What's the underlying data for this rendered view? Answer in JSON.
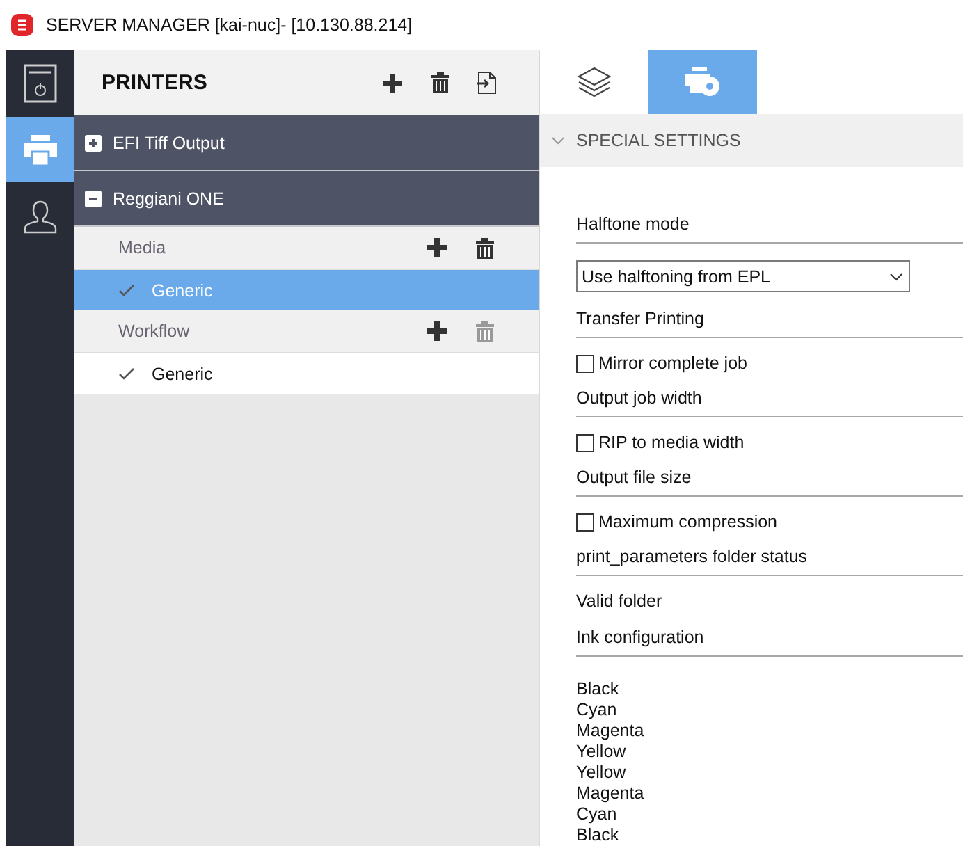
{
  "window": {
    "title": "SERVER MANAGER [kai-nuc]- [10.130.88.214]"
  },
  "nav": [
    {
      "kind": "server",
      "selected": false
    },
    {
      "kind": "printers",
      "selected": true
    },
    {
      "kind": "users",
      "selected": false
    }
  ],
  "printers_panel": {
    "title": "PRINTERS",
    "printers": [
      {
        "name": "EFI Tiff Output",
        "expanded": false
      },
      {
        "name": "Reggiani ONE",
        "expanded": true,
        "sections": [
          {
            "title": "Media",
            "delete_disabled": false,
            "items": [
              {
                "name": "Generic",
                "checked": true,
                "selected": true
              }
            ]
          },
          {
            "title": "Workflow",
            "delete_disabled": true,
            "items": [
              {
                "name": "Generic",
                "checked": true,
                "selected": false
              }
            ]
          }
        ]
      }
    ]
  },
  "tabs": [
    {
      "kind": "layers",
      "selected": false
    },
    {
      "kind": "printer-settings",
      "selected": true
    }
  ],
  "settings": {
    "title": "SPECIAL SETTINGS",
    "expanded": true,
    "fields": [
      {
        "kind": "heading",
        "label": "Halftone mode"
      },
      {
        "kind": "select",
        "value": "Use halftoning from EPL"
      },
      {
        "kind": "heading",
        "label": "Transfer Printing"
      },
      {
        "kind": "checkbox",
        "label": "Mirror complete job",
        "checked": false
      },
      {
        "kind": "heading",
        "label": "Output job width"
      },
      {
        "kind": "checkbox",
        "label": "RIP to media width",
        "checked": false
      },
      {
        "kind": "heading",
        "label": "Output file size"
      },
      {
        "kind": "checkbox",
        "label": "Maximum compression",
        "checked": false
      },
      {
        "kind": "heading",
        "label": "print_parameters folder status"
      },
      {
        "kind": "text",
        "label": "Valid folder"
      },
      {
        "kind": "heading",
        "label": "Ink configuration"
      },
      {
        "kind": "list",
        "items": [
          "Black",
          "Cyan",
          "Magenta",
          "Yellow",
          "Yellow",
          "Magenta",
          "Cyan",
          "Black"
        ]
      }
    ]
  }
}
